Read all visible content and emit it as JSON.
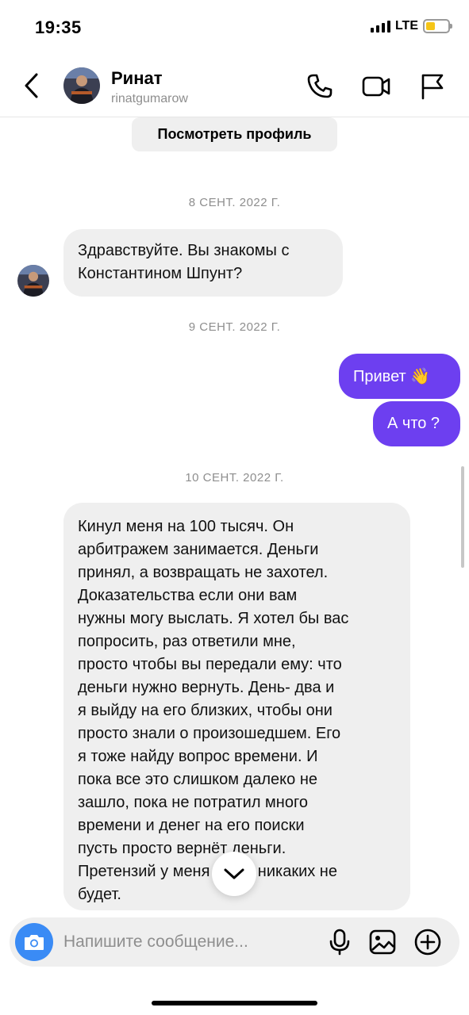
{
  "status_bar": {
    "time": "19:35",
    "network": "LTE"
  },
  "header": {
    "name": "Ринат",
    "username": "rinatgumarow",
    "icons": [
      "back-icon",
      "phone-icon",
      "video-icon",
      "flag-icon"
    ]
  },
  "chat": {
    "view_profile": "Посмотреть профиль",
    "date_1": "8 СЕНТ. 2022 Г.",
    "msg_1": [
      "Здравствуйте. Вы знакомы с",
      "Константином Шпунт?"
    ],
    "date_2": "9 СЕНТ. 2022 Г.",
    "msg_2": "Привет 👋",
    "msg_3": "А что ?",
    "date_3": "10 СЕНТ. 2022 Г.",
    "msg_4": [
      "Кинул меня на 100 тысяч. Он",
      "арбитражем занимается. Деньги",
      "принял, а возвращать не захотел.",
      "Доказательства если они вам",
      "нужны могу выслать. Я хотел бы вас",
      "попросить, раз ответили мне,",
      "просто чтобы вы передали ему: что",
      "деньги нужно вернуть. День- два и",
      "я выйду на его близких, чтобы они",
      "просто знали о произошедшем. Его",
      "я тоже найду вопрос времени. И",
      "пока все это слишком далеко не",
      "зашло, пока не потратил много",
      "времени и денег на его поиски",
      "пусть просто вернёт деньги.",
      "Претензий у меня тогда никаких не",
      "будет."
    ]
  },
  "composer": {
    "placeholder": "Напишите сообщение..."
  },
  "colors": {
    "outgoing_bubble": "#6d3ff0",
    "incoming_bubble": "#efefef",
    "camera_button": "#3a8bf5"
  }
}
